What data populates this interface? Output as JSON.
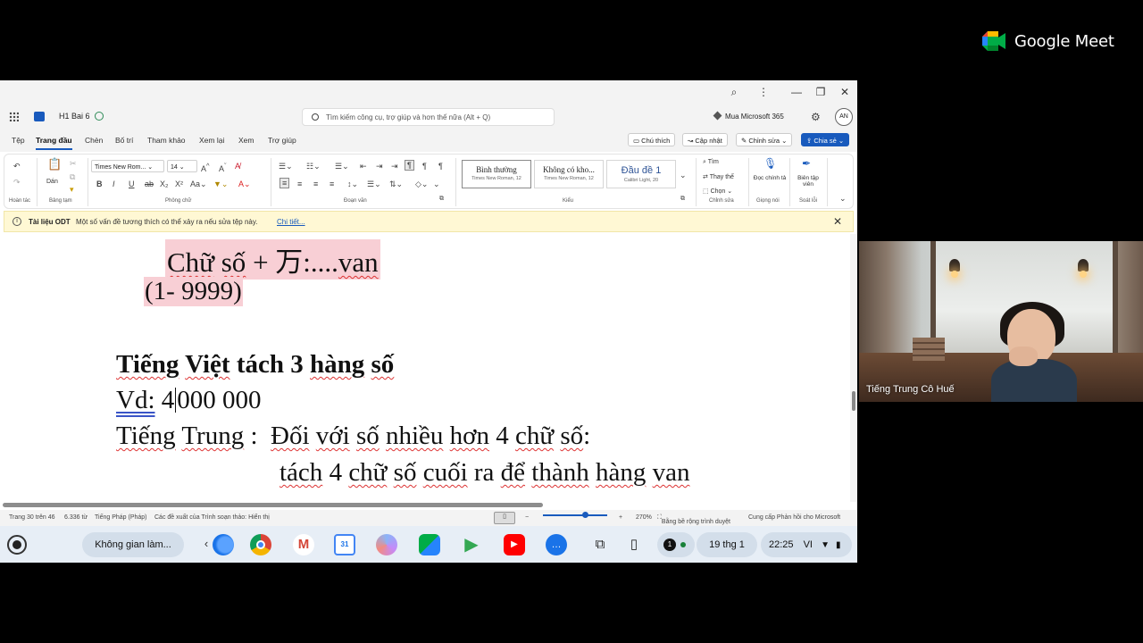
{
  "meet": {
    "brand": "Google Meet"
  },
  "word": {
    "doc_name": "H1 Bai 6",
    "search_placeholder": "Tìm kiếm công cụ, trợ giúp và hơn thế nữa (Alt + Q)",
    "buy": "Mua Microsoft 365",
    "avatar": "AN",
    "tabs": [
      "Tệp",
      "Trang đầu",
      "Chèn",
      "Bố trí",
      "Tham khảo",
      "Xem lại",
      "Xem",
      "Trợ giúp"
    ],
    "active_tab": "Trang đầu",
    "right_buttons": {
      "comments": "Chú thích",
      "update": "Cập nhật",
      "editing": "Chỉnh sửa",
      "share": "Chia sẻ"
    },
    "ribbon": {
      "undo_label": "Hoàn tác",
      "paste_label": "Dán",
      "clipboard_label": "Bảng tạm",
      "font_name": "Times New Rom...",
      "font_size": "14",
      "font_label": "Phông chữ",
      "paragraph_label": "Đoạn văn",
      "styles_label": "Kiểu",
      "styles": [
        {
          "name": "Bình thường",
          "sub": "Times New Roman, 12"
        },
        {
          "name": "Không có kho...",
          "sub": "Times New Roman, 12"
        },
        {
          "name": "Đầu đề 1",
          "sub": "Calibri Light, 20"
        }
      ],
      "find": "Tìm",
      "replace": "Thay thế",
      "select": "Chọn",
      "editing_label": "Chỉnh sửa",
      "dictate": "Đọc chính tả",
      "voice_label": "Giọng nói",
      "editor": "Biên tập viên",
      "proofing_label": "Soát lỗi"
    },
    "infobar": {
      "title": "Tài liệu ODT",
      "message": "Một số vấn đề tương thích có thể xảy ra nếu sửa tệp này.",
      "link": "Chi tiết..."
    },
    "document": {
      "line1_a": "Chữ",
      "line1_b": "số",
      "line1_c": " + 万:....",
      "line1_d": "van",
      "line2": "(1- 9999)",
      "heading_a": "Tiếng",
      "heading_b": " ",
      "heading_c": "Việt",
      "heading_d": " tách 3 ",
      "heading_e": "hàng",
      "heading_f": " ",
      "heading_g": "số",
      "vd_label": "Vd:",
      "vd_pre": " 4",
      "vd_post": "000 000",
      "tt_a": "Tiếng",
      "tt_b": " ",
      "tt_c": "Trung",
      "tt_d": " :  ",
      "tt_e": "Đối",
      "tt_f": " ",
      "tt_g": "với",
      "tt_h": " ",
      "tt_i": "số",
      "tt_j": " ",
      "tt_k": "nhiều",
      "tt_l": " ",
      "tt_m": "hơn",
      "tt_n": " 4 ",
      "tt_o": "chữ",
      "tt_p": " ",
      "tt_q": "số",
      "tt_r": ":",
      "l6_a": "tách",
      "l6_b": " 4 ",
      "l6_c": "chữ",
      "l6_d": " ",
      "l6_e": "số",
      "l6_f": " ",
      "l6_g": "cuối",
      "l6_h": " ra ",
      "l6_i": "để",
      "l6_j": " ",
      "l6_k": "thành",
      "l6_l": " ",
      "l6_m": "hàng",
      "l6_n": " ",
      "l6_o": "van"
    },
    "status": {
      "page": "Trang 30 trên 46",
      "words": "6.336 từ",
      "lang": "Tiếng Pháp (Pháp)",
      "suggestions": "Các đề xuất của Trình soạn thảo: Hiển thị",
      "zoom": "270%",
      "fit": "Bằng bề rộng trình duyệt",
      "feedback": "Cung cấp Phản hồi cho Microsoft"
    }
  },
  "shelf": {
    "desk": "Không gian làm...",
    "notifications": "1",
    "date": "19 thg 1",
    "time": "22:25",
    "ime": "VI"
  },
  "participant": {
    "name": "Tiếng Trung Cô Huế"
  },
  "colors": {
    "word_blue": "#185abd",
    "highlight": "#f8cfd5",
    "spell_red": "#d33"
  }
}
